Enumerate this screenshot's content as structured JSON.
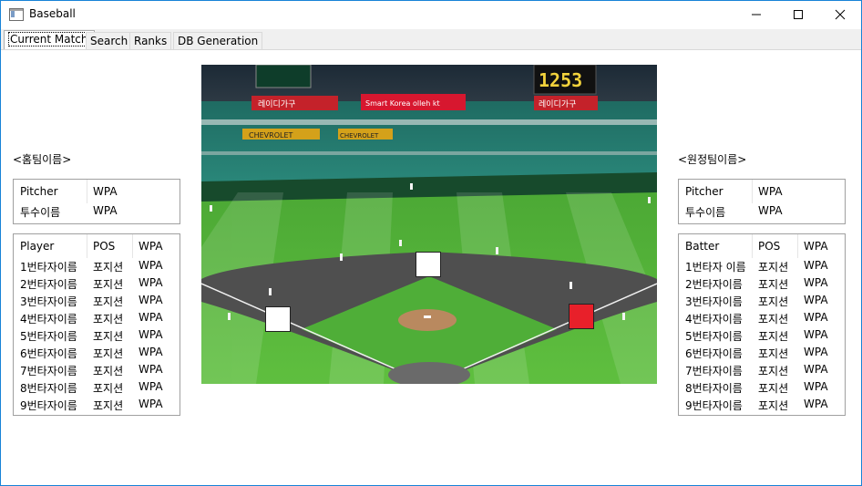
{
  "window": {
    "title": "Baseball"
  },
  "tabs": [
    "Current Match",
    "Search",
    "Ranks",
    "DB Generation"
  ],
  "home": {
    "team_label": "<홈팀이름>",
    "pitcher_header": [
      "Pitcher",
      "WPA"
    ],
    "pitcher_row": [
      "투수이름",
      "WPA"
    ],
    "lineup_header": [
      "Player",
      "POS",
      "WPA"
    ],
    "lineup": [
      [
        "1번타자이름",
        "포지션",
        "WPA"
      ],
      [
        "2번타자이름",
        "포지션",
        "WPA"
      ],
      [
        "3번타자이름",
        "포지션",
        "WPA"
      ],
      [
        "4번타자이름",
        "포지션",
        "WPA"
      ],
      [
        "5번타자이름",
        "포지션",
        "WPA"
      ],
      [
        "6번타자이름",
        "포지션",
        "WPA"
      ],
      [
        "7번타자이름",
        "포지션",
        "WPA"
      ],
      [
        "8번타자이름",
        "포지션",
        "WPA"
      ],
      [
        "9번타자이름",
        "포지션",
        "WPA"
      ]
    ]
  },
  "away": {
    "team_label": "<원정팀이름>",
    "pitcher_header": [
      "Pitcher",
      "WPA"
    ],
    "pitcher_row": [
      "투수이름",
      "WPA"
    ],
    "lineup_header": [
      "Batter",
      "POS",
      "WPA"
    ],
    "lineup": [
      [
        "1번타자 이름",
        "포지션",
        "WPA"
      ],
      [
        "2번타자이름",
        "포지션",
        "WPA"
      ],
      [
        "3번타자이름",
        "포지션",
        "WPA"
      ],
      [
        "4번타자이름",
        "포지션",
        "WPA"
      ],
      [
        "5번타자이름",
        "포지션",
        "WPA"
      ],
      [
        "6번타자이름",
        "포지션",
        "WPA"
      ],
      [
        "7번타자이름",
        "포지션",
        "WPA"
      ],
      [
        "8번타자이름",
        "포지션",
        "WPA"
      ],
      [
        "9번타자이름",
        "포지션",
        "WPA"
      ]
    ]
  },
  "stadium_signs": {
    "left_banner": "레이디가구",
    "center_banner": "Smart Korea olleh kt",
    "right_banner": "레이디가구",
    "sponsor_left": "CHEVROLET",
    "sponsor_mid": "CHEVROLET",
    "scoreboard": "1253"
  },
  "bases": {
    "first": "occupied",
    "second": "empty",
    "third": "empty"
  },
  "colors": {
    "occupied": "#e8202a",
    "empty": "#ffffff"
  }
}
